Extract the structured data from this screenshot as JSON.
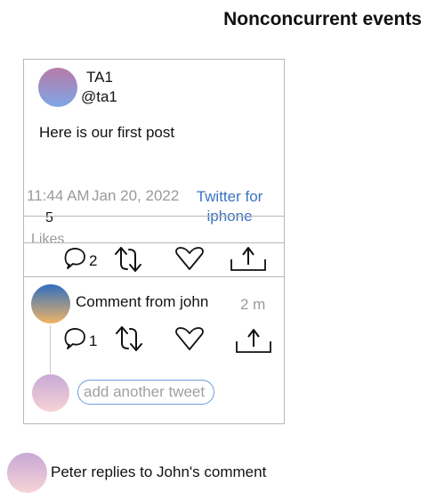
{
  "page": {
    "title": "Nonconcurrent events"
  },
  "post": {
    "author_name": "TA1",
    "author_handle": "@ta1",
    "text": "Here is our first post",
    "time": "11:44 AM",
    "date": "Jan 20, 2022",
    "dot": ".",
    "source": "Twitter for iphone",
    "likes_count": "5",
    "likes_label": "Likes",
    "actions": {
      "reply_icon": "speech-bubble-icon",
      "reply_count": "2",
      "retweet_icon": "retweet-arrows-icon",
      "like_icon": "heart-icon",
      "share_icon": "share-upload-icon"
    }
  },
  "comment": {
    "text": "Comment from john",
    "time": "2 m",
    "reply_count": "1"
  },
  "reply_box": {
    "placeholder": "add another tweet"
  },
  "footer": {
    "text": "Peter replies to John's comment"
  },
  "colors": {
    "border": "#b8b8b8",
    "muted_text": "#9a9a9a",
    "link": "#3a72c4",
    "input_border": "#6aa0d8"
  }
}
